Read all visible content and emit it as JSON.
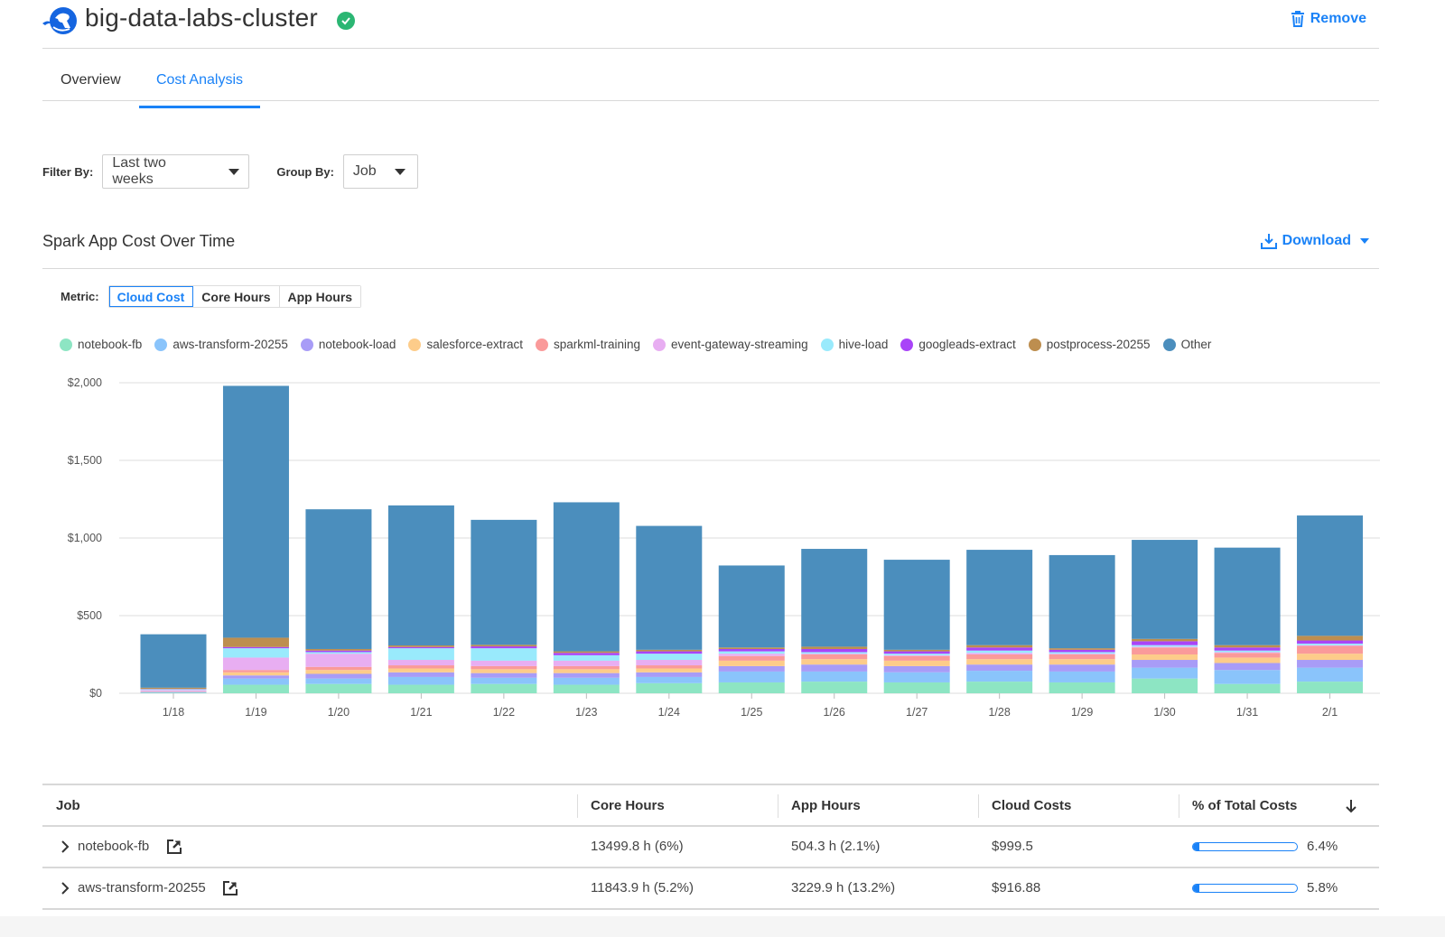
{
  "header": {
    "title": "big-data-labs-cluster",
    "status_icon": "check-circle-icon",
    "remove_label": "Remove"
  },
  "tabs": [
    {
      "label": "Overview",
      "active": false
    },
    {
      "label": "Cost Analysis",
      "active": true
    }
  ],
  "filters": {
    "filter_by_label": "Filter By:",
    "filter_by_value": "Last two weeks",
    "group_by_label": "Group By:",
    "group_by_value": "Job"
  },
  "section": {
    "title": "Spark App Cost Over Time",
    "download_label": "Download"
  },
  "metric": {
    "label": "Metric:",
    "options": [
      "Cloud Cost",
      "Core Hours",
      "App Hours"
    ],
    "selected": "Cloud Cost"
  },
  "colors": {
    "accent": "#1a82f7",
    "status_ok": "#2bb673"
  },
  "chart_data": {
    "type": "bar",
    "stacked": true,
    "title": "Spark App Cost Over Time",
    "xlabel": "",
    "ylabel": "",
    "ylim": [
      0,
      2000
    ],
    "yticks": [
      "$0",
      "$500",
      "$1,000",
      "$1,500",
      "$2,000"
    ],
    "ytick_values": [
      0,
      500,
      1000,
      1500,
      2000
    ],
    "grid": true,
    "legend_position": "top-left",
    "categories": [
      "1/18",
      "1/19",
      "1/20",
      "1/21",
      "1/22",
      "1/23",
      "1/24",
      "1/25",
      "1/26",
      "1/27",
      "1/28",
      "1/29",
      "1/30",
      "1/31",
      "2/1"
    ],
    "series": [
      {
        "name": "notebook-fb",
        "color": "#8de5c3",
        "values": [
          3,
          55,
          60,
          55,
          60,
          55,
          65,
          70,
          75,
          70,
          75,
          70,
          95,
          60,
          75
        ]
      },
      {
        "name": "aws-transform-20255",
        "color": "#8ac4fb",
        "values": [
          3,
          40,
          35,
          50,
          40,
          45,
          40,
          70,
          65,
          65,
          70,
          70,
          70,
          90,
          90
        ]
      },
      {
        "name": "notebook-load",
        "color": "#a89cf7",
        "values": [
          3,
          20,
          30,
          30,
          30,
          30,
          30,
          35,
          45,
          40,
          40,
          45,
          50,
          45,
          50
        ]
      },
      {
        "name": "salesforce-extract",
        "color": "#fdcc8a",
        "values": [
          2,
          20,
          25,
          25,
          25,
          25,
          25,
          35,
          35,
          35,
          35,
          35,
          35,
          35,
          40
        ]
      },
      {
        "name": "sparkml-training",
        "color": "#fa9a9a",
        "values": [
          2,
          15,
          20,
          20,
          20,
          20,
          20,
          30,
          30,
          30,
          30,
          30,
          45,
          30,
          50
        ]
      },
      {
        "name": "event-gateway-streaming",
        "color": "#e8aef2",
        "values": [
          8,
          80,
          85,
          35,
          35,
          35,
          35,
          15,
          5,
          5,
          10,
          5,
          5,
          5,
          5
        ]
      },
      {
        "name": "hive-load",
        "color": "#99eafc",
        "values": [
          5,
          60,
          10,
          75,
          80,
          35,
          40,
          15,
          10,
          10,
          15,
          10,
          10,
          10,
          10
        ]
      },
      {
        "name": "googleads-extract",
        "color": "#a944f8",
        "values": [
          2,
          8,
          10,
          8,
          12,
          15,
          15,
          15,
          20,
          15,
          20,
          15,
          25,
          20,
          20
        ]
      },
      {
        "name": "postprocess-20255",
        "color": "#bd8e4f",
        "values": [
          8,
          60,
          10,
          10,
          10,
          10,
          10,
          10,
          15,
          10,
          15,
          10,
          15,
          15,
          30
        ]
      },
      {
        "name": "Other",
        "color": "#4b8ebd",
        "values": [
          344,
          1622,
          900,
          902,
          805,
          960,
          798,
          528,
          630,
          580,
          614,
          600,
          638,
          628,
          775
        ]
      }
    ]
  },
  "table": {
    "columns": [
      "Job",
      "Core Hours",
      "App Hours",
      "Cloud Costs",
      "% of Total Costs"
    ],
    "sort_column": "% of Total Costs",
    "sort_direction": "descending",
    "rows": [
      {
        "job": "notebook-fb",
        "core_hours": "13499.8 h (6%)",
        "app_hours": "504.3 h (2.1%)",
        "cloud_costs": "$999.5",
        "pct_total": "6.4%",
        "pct_value": 6.4
      },
      {
        "job": "aws-transform-20255",
        "core_hours": "11843.9 h (5.2%)",
        "app_hours": "3229.9 h (13.2%)",
        "cloud_costs": "$916.88",
        "pct_total": "5.8%",
        "pct_value": 5.8
      }
    ]
  }
}
